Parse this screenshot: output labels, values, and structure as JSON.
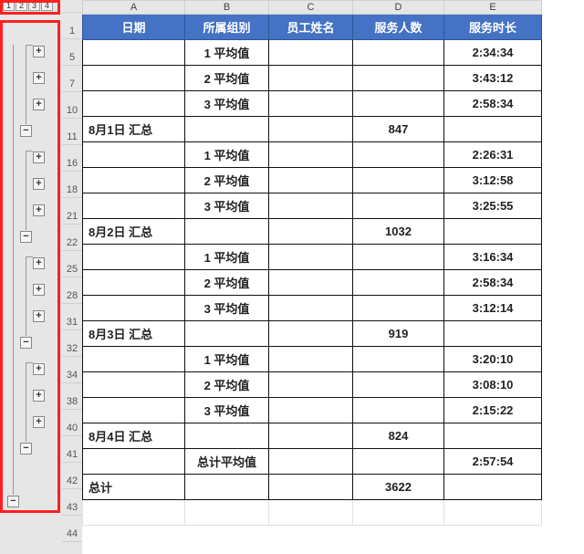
{
  "columns": [
    "A",
    "B",
    "C",
    "D",
    "E"
  ],
  "header": {
    "A": "日期",
    "B": "所属组别",
    "C": "员工姓名",
    "D": "服务人数",
    "E": "服务时长"
  },
  "outline_levels": [
    "1",
    "2",
    "3",
    "4"
  ],
  "outline_buttons": [
    {
      "kind": "plus",
      "col": 3,
      "rowIdx": 1
    },
    {
      "kind": "plus",
      "col": 3,
      "rowIdx": 2
    },
    {
      "kind": "plus",
      "col": 3,
      "rowIdx": 3
    },
    {
      "kind": "minus",
      "col": 2,
      "rowIdx": 4
    },
    {
      "kind": "plus",
      "col": 3,
      "rowIdx": 5
    },
    {
      "kind": "plus",
      "col": 3,
      "rowIdx": 6
    },
    {
      "kind": "plus",
      "col": 3,
      "rowIdx": 7
    },
    {
      "kind": "minus",
      "col": 2,
      "rowIdx": 8
    },
    {
      "kind": "plus",
      "col": 3,
      "rowIdx": 9
    },
    {
      "kind": "plus",
      "col": 3,
      "rowIdx": 10
    },
    {
      "kind": "plus",
      "col": 3,
      "rowIdx": 11
    },
    {
      "kind": "minus",
      "col": 2,
      "rowIdx": 12
    },
    {
      "kind": "plus",
      "col": 3,
      "rowIdx": 13
    },
    {
      "kind": "plus",
      "col": 3,
      "rowIdx": 14
    },
    {
      "kind": "plus",
      "col": 3,
      "rowIdx": 15
    },
    {
      "kind": "minus",
      "col": 2,
      "rowIdx": 16
    },
    {
      "kind": "minus",
      "col": 1,
      "rowIdx": 18
    }
  ],
  "row_numbers": [
    "1",
    "5",
    "7",
    "10",
    "11",
    "16",
    "18",
    "21",
    "22",
    "25",
    "28",
    "31",
    "32",
    "34",
    "38",
    "40",
    "41",
    "42",
    "43",
    "44"
  ],
  "rows": [
    {
      "rn": "1",
      "type": "hdr"
    },
    {
      "rn": "5",
      "type": "avg",
      "B": "1 平均值",
      "E": "2:34:34"
    },
    {
      "rn": "7",
      "type": "avg",
      "B": "2 平均值",
      "E": "3:43:12"
    },
    {
      "rn": "10",
      "type": "avg",
      "B": "3 平均值",
      "E": "2:58:34"
    },
    {
      "rn": "11",
      "type": "sum",
      "A": "8月1日 汇总",
      "D": "847"
    },
    {
      "rn": "16",
      "type": "avg",
      "B": "1 平均值",
      "E": "2:26:31"
    },
    {
      "rn": "18",
      "type": "avg",
      "B": "2 平均值",
      "E": "3:12:58"
    },
    {
      "rn": "21",
      "type": "avg",
      "B": "3 平均值",
      "E": "3:25:55"
    },
    {
      "rn": "22",
      "type": "sum",
      "A": "8月2日 汇总",
      "D": "1032"
    },
    {
      "rn": "25",
      "type": "avg",
      "B": "1 平均值",
      "E": "3:16:34"
    },
    {
      "rn": "28",
      "type": "avg",
      "B": "2 平均值",
      "E": "2:58:34"
    },
    {
      "rn": "31",
      "type": "avg",
      "B": "3 平均值",
      "E": "3:12:14"
    },
    {
      "rn": "32",
      "type": "sum",
      "A": "8月3日 汇总",
      "D": "919"
    },
    {
      "rn": "34",
      "type": "avg",
      "B": "1 平均值",
      "E": "3:20:10"
    },
    {
      "rn": "38",
      "type": "avg",
      "B": "2 平均值",
      "E": "3:08:10"
    },
    {
      "rn": "40",
      "type": "avg",
      "B": "3 平均值",
      "E": "2:15:22"
    },
    {
      "rn": "41",
      "type": "sum",
      "A": "8月4日 汇总",
      "D": "824"
    },
    {
      "rn": "42",
      "type": "gavg",
      "B": "总计平均值",
      "E": "2:57:54"
    },
    {
      "rn": "43",
      "type": "gsum",
      "A": "总计",
      "D": "3622"
    },
    {
      "rn": "44",
      "type": "blank"
    }
  ],
  "chart_data": {
    "type": "table",
    "title": "分级显示 汇总",
    "columns": [
      "日期",
      "所属组别",
      "员工姓名",
      "服务人数",
      "服务时长"
    ],
    "rows": [
      [
        "",
        "1 平均值",
        "",
        "",
        "2:34:34"
      ],
      [
        "",
        "2 平均值",
        "",
        "",
        "3:43:12"
      ],
      [
        "",
        "3 平均值",
        "",
        "",
        "2:58:34"
      ],
      [
        "8月1日 汇总",
        "",
        "",
        "847",
        ""
      ],
      [
        "",
        "1 平均值",
        "",
        "",
        "2:26:31"
      ],
      [
        "",
        "2 平均值",
        "",
        "",
        "3:12:58"
      ],
      [
        "",
        "3 平均值",
        "",
        "",
        "3:25:55"
      ],
      [
        "8月2日 汇总",
        "",
        "",
        "1032",
        ""
      ],
      [
        "",
        "1 平均值",
        "",
        "",
        "3:16:34"
      ],
      [
        "",
        "2 平均值",
        "",
        "",
        "2:58:34"
      ],
      [
        "",
        "3 平均值",
        "",
        "",
        "3:12:14"
      ],
      [
        "8月3日 汇总",
        "",
        "",
        "919",
        ""
      ],
      [
        "",
        "1 平均值",
        "",
        "",
        "3:20:10"
      ],
      [
        "",
        "2 平均值",
        "",
        "",
        "3:08:10"
      ],
      [
        "",
        "3 平均值",
        "",
        "",
        "2:15:22"
      ],
      [
        "8月4日 汇总",
        "",
        "",
        "824",
        ""
      ],
      [
        "",
        "总计平均值",
        "",
        "",
        "2:57:54"
      ],
      [
        "总计",
        "",
        "",
        "3622",
        ""
      ]
    ]
  }
}
